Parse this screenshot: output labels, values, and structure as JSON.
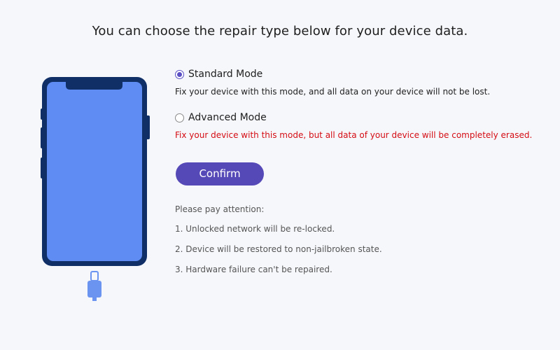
{
  "header": {
    "title": "You can choose the repair type below for your device data."
  },
  "modes": {
    "standard": {
      "label": "Standard Mode",
      "description": "Fix your device with this mode, and all data on your device will not be lost.",
      "selected": true
    },
    "advanced": {
      "label": "Advanced Mode",
      "description": "Fix your device with this mode, but all data of your device will be completely erased.",
      "selected": false
    }
  },
  "confirm_button": {
    "label": "Confirm"
  },
  "attention": {
    "title": "Please pay attention:",
    "items": [
      "1. Unlocked network will be re-locked.",
      "2. Device will be restored to non-jailbroken state.",
      "3. Hardware failure can't be repaired."
    ]
  },
  "colors": {
    "accent": "#5548b7",
    "danger": "#d40d14",
    "phone_frame": "#0f2f66",
    "phone_screen": "#5f8cf2",
    "cable": "#6b94f0",
    "background": "#f6f7fb"
  },
  "icons": {
    "device": "phone-icon",
    "cable": "usb-cable-icon"
  }
}
